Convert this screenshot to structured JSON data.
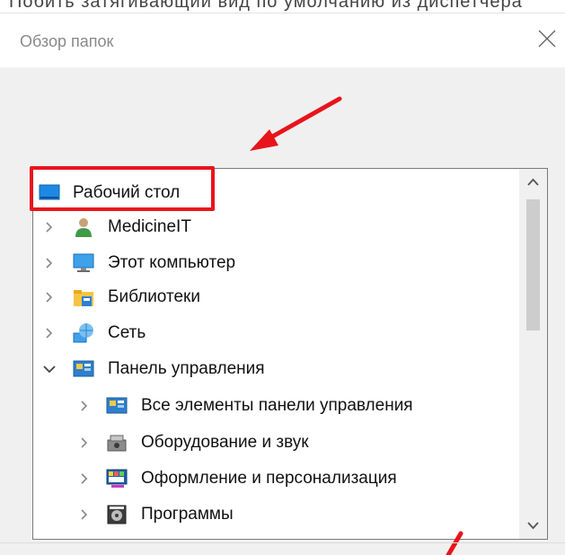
{
  "background_text": "Побить затягивающий вид по умолчанию из диспетчера",
  "window": {
    "title": "Обзор папок"
  },
  "tree": {
    "items": [
      {
        "label": "Рабочий стол",
        "icon": "desktop-icon",
        "expander": "none"
      },
      {
        "label": "MedicineIT",
        "icon": "user-icon",
        "expander": "collapsed"
      },
      {
        "label": "Этот компьютер",
        "icon": "computer-icon",
        "expander": "collapsed"
      },
      {
        "label": "Библиотеки",
        "icon": "libraries-icon",
        "expander": "collapsed"
      },
      {
        "label": "Сеть",
        "icon": "network-icon",
        "expander": "collapsed"
      },
      {
        "label": "Панель управления",
        "icon": "control-panel-icon",
        "expander": "expanded"
      },
      {
        "label": "Все элементы панели управления",
        "icon": "control-panel-icon",
        "expander": "collapsed"
      },
      {
        "label": "Оборудование и звук",
        "icon": "hardware-sound-icon",
        "expander": "collapsed"
      },
      {
        "label": "Оформление и персонализация",
        "icon": "personalization-icon",
        "expander": "collapsed"
      },
      {
        "label": "Программы",
        "icon": "programs-icon",
        "expander": "collapsed"
      }
    ]
  },
  "colors": {
    "annotation": "#e8141c"
  }
}
